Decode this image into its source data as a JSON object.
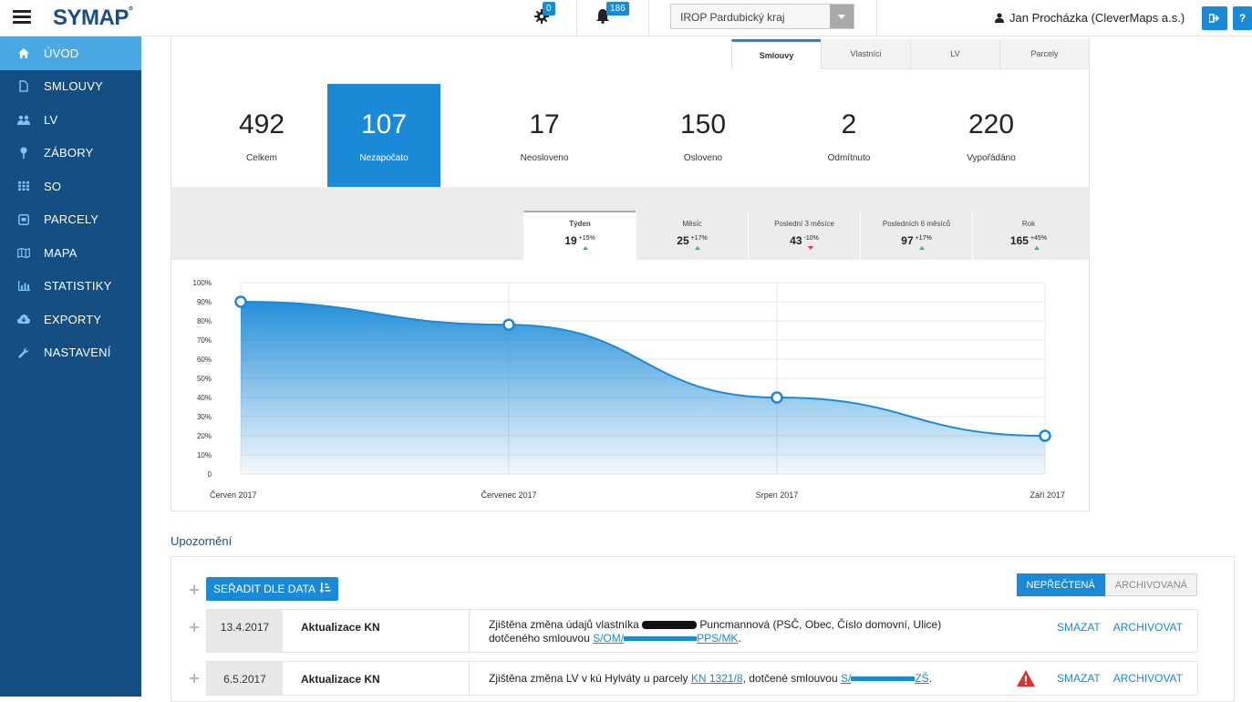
{
  "app": {
    "logo": "SYMAP",
    "logo_mark": "°",
    "settings_badge": "0",
    "notifications_badge": "186",
    "project": "IROP Pardubický kraj",
    "user": "Jan Procházka (CleverMaps a.s.)",
    "help_label": "?"
  },
  "sidebar": {
    "items": [
      {
        "label": "ÚVOD",
        "icon": "home-icon"
      },
      {
        "label": "SMLOUVY",
        "icon": "document-icon"
      },
      {
        "label": "LV",
        "icon": "users-icon"
      },
      {
        "label": "ZÁBORY",
        "icon": "pin-icon"
      },
      {
        "label": "SO",
        "icon": "grid-icon"
      },
      {
        "label": "PARCELY",
        "icon": "parcel-icon"
      },
      {
        "label": "MAPA",
        "icon": "map-icon"
      },
      {
        "label": "STATISTIKY",
        "icon": "bar-chart-icon"
      },
      {
        "label": "EXPORTY",
        "icon": "cloud-icon"
      },
      {
        "label": "NASTAVENÍ",
        "icon": "wrench-icon"
      }
    ]
  },
  "tabs": [
    "Smlouvy",
    "Vlastníci",
    "LV",
    "Parcely"
  ],
  "stats": [
    {
      "value": "492",
      "label": "Celkem"
    },
    {
      "value": "107",
      "label": "Nezapočato"
    },
    {
      "value": "17",
      "label": "Neosloveno"
    },
    {
      "value": "150",
      "label": "Osloveno"
    },
    {
      "value": "2",
      "label": "Odmítnuto"
    },
    {
      "value": "220",
      "label": "Vypořádáno"
    }
  ],
  "periods": [
    {
      "label": "Týden",
      "value": "19",
      "change": "+15%",
      "trend": "up"
    },
    {
      "label": "Měsíc",
      "value": "25",
      "change": "+17%",
      "trend": "up"
    },
    {
      "label": "Poslední 3 měsíce",
      "value": "43",
      "change": "-10%",
      "trend": "down"
    },
    {
      "label": "Posledních 6 měsíců",
      "value": "97",
      "change": "+17%",
      "trend": "up"
    },
    {
      "label": "Rok",
      "value": "165",
      "change": "+45%",
      "trend": "up"
    }
  ],
  "chart_data": {
    "type": "area",
    "categories": [
      "Červen 2017",
      "Červenec 2017",
      "Srpen 2017",
      "Září 2017"
    ],
    "values": [
      90,
      78,
      40,
      20
    ],
    "y_ticks": [
      "0",
      "10%",
      "20%",
      "30%",
      "40%",
      "50%",
      "60%",
      "70%",
      "80%",
      "90%",
      "100%"
    ],
    "ylim": [
      0,
      100
    ],
    "color": "#1a8ad6",
    "grid": true
  },
  "notifications": {
    "title": "Upozornění",
    "sort_label": "SEŘADIT DLE DATA",
    "filter_unread": "NEPŘEČTENÁ",
    "filter_archived": "ARCHIVOVANÁ",
    "delete_label": "SMAZAT",
    "archive_label": "ARCHIVOVAT",
    "rows": [
      {
        "date": "13.4.2017",
        "type": "Aktualizace KN",
        "text_1": "Zjištěna změna údajů vlastníka ",
        "text_2": " Puncmannová (PSČ, Obec, Číslo domovní, Ulice)",
        "text_3": "dotčeného smlouvou ",
        "link_prefix": "S/OM/",
        "link_suffix": "PPS/MK",
        "text_4": "."
      },
      {
        "date": "6.5.2017",
        "type": "Aktualizace KN",
        "text_1": "Zjištěna změna LV v kú Hylváty u parcely ",
        "link_1": "KN 1321/8",
        "text_2": ", dotčené smlouvou ",
        "link_prefix": "S/",
        "link_suffix": "ZŠ",
        "text_3": "."
      }
    ]
  }
}
